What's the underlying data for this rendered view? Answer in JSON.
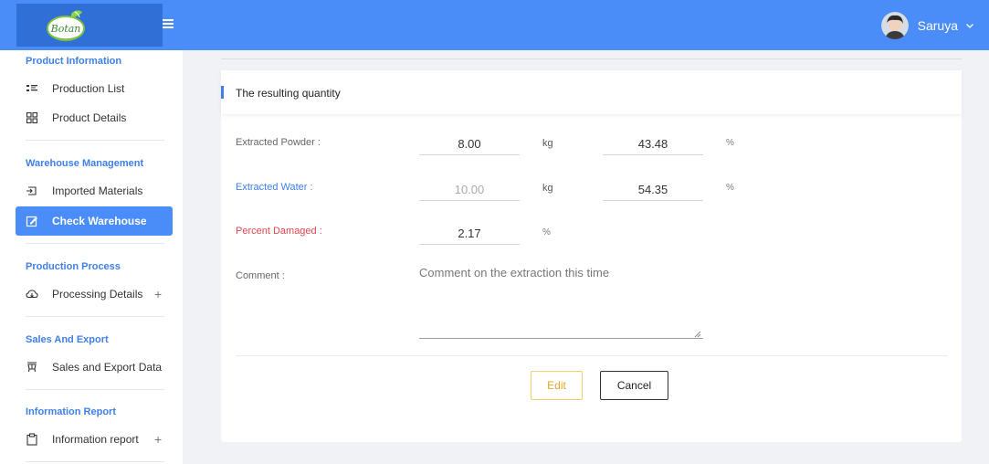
{
  "header": {
    "user_name": "Saruya",
    "colors": {
      "header_bg": "#4a8df8",
      "accent": "#3f7fe8",
      "danger": "#e0464e",
      "edit_border": "#f3d16b"
    },
    "icons": {
      "menu": "hamburger-icon",
      "caret": "chevron-down-icon",
      "logo": "botanic-logo"
    }
  },
  "sidebar": {
    "sections": [
      {
        "title": "Product Information",
        "items": [
          {
            "label": "Production List",
            "icon": "list-icon"
          },
          {
            "label": "Product Details",
            "icon": "grid-icon"
          }
        ]
      },
      {
        "title": "Warehouse Management",
        "items": [
          {
            "label": "Imported Materials",
            "icon": "import-icon"
          },
          {
            "label": "Check Warehouse",
            "icon": "edit-check-icon",
            "active": true
          }
        ]
      },
      {
        "title": "Production Process",
        "items": [
          {
            "label": "Processing Details",
            "icon": "cloud-icon",
            "expand": "+"
          }
        ]
      },
      {
        "title": "Sales And Export",
        "items": [
          {
            "label": "Sales and Export Data",
            "icon": "cart-icon"
          }
        ]
      },
      {
        "title": "Information Report",
        "items": [
          {
            "label": "Information report",
            "icon": "clipboard-icon",
            "expand": "+"
          }
        ]
      }
    ]
  },
  "card": {
    "title": "The resulting quantity",
    "fields": {
      "extracted_powder": {
        "label": "Extracted Powder :",
        "value": "8.00",
        "unit": "kg",
        "percent": "43.48",
        "percent_unit": "%"
      },
      "extracted_water": {
        "label": "Extracted Water :",
        "value": "10.00",
        "unit": "kg",
        "percent": "54.35",
        "percent_unit": "%"
      },
      "percent_damaged": {
        "label": "Percent Damaged :",
        "value": "2.17",
        "unit": "%"
      },
      "comment": {
        "label": "Comment :",
        "placeholder": "Comment on the extraction this time",
        "value": ""
      }
    },
    "buttons": {
      "edit": "Edit",
      "cancel": "Cancel"
    }
  }
}
